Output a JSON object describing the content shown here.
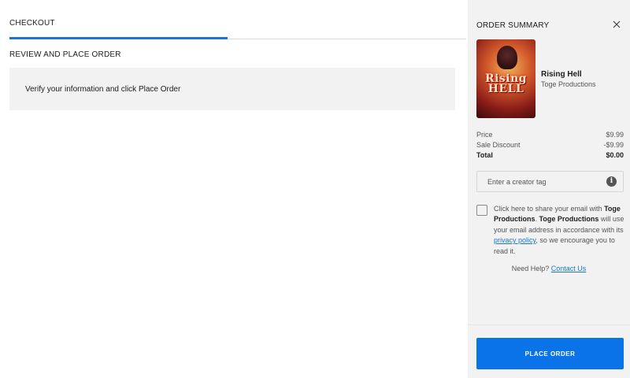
{
  "checkout": {
    "tab_label": "CHECKOUT",
    "section_title": "REVIEW AND PLACE ORDER",
    "info_text": "Verify your information and click Place Order"
  },
  "summary": {
    "title": "ORDER SUMMARY",
    "close_icon": "close-icon",
    "product": {
      "cover_title_line1": "Rising",
      "cover_title_line2": "HELL",
      "name": "Rising Hell",
      "developer": "Toge Productions"
    },
    "price": {
      "label": "Price",
      "value": "$9.99"
    },
    "discount": {
      "label": "Sale Discount",
      "value": "-$9.99"
    },
    "total": {
      "label": "Total",
      "value": "$0.00"
    },
    "creator_tag": {
      "placeholder": "Enter a creator tag",
      "value": "",
      "info_icon": "i"
    },
    "share": {
      "prefix": "Click here to share your email with ",
      "company1": "Toge Productions",
      "mid1": ". ",
      "company2": "Toge Productions",
      "mid2": " will use your email address in accordance with its ",
      "link": "privacy policy",
      "suffix": ", so we encourage you to read it."
    },
    "help": {
      "text": "Need Help? ",
      "link": "Contact Us"
    },
    "place_order_label": "PLACE ORDER"
  },
  "colors": {
    "accent": "#1a75d1",
    "button": "#0a73e8",
    "panel": "#f2f2f2"
  }
}
